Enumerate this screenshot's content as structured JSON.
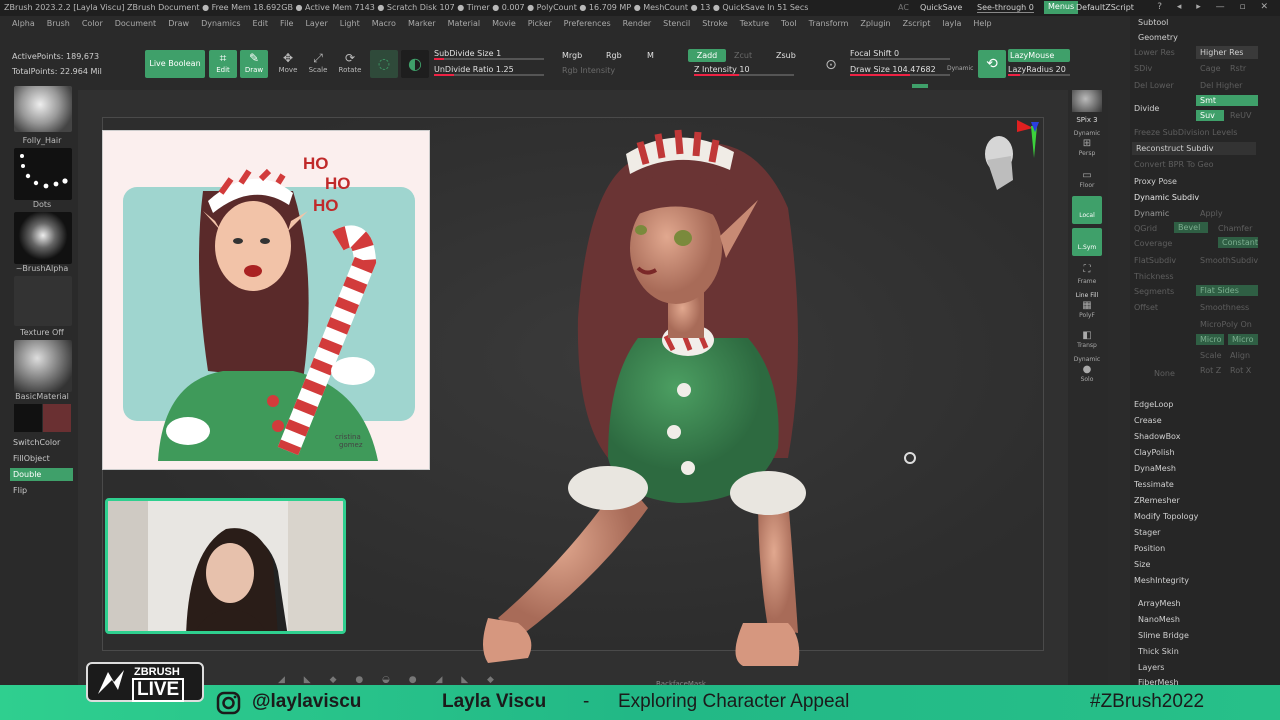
{
  "titlebar": {
    "title": "ZBrush 2023.2.2 [Layla Viscu]   ZBrush Document    ● Free Mem 18.692GB ● Active Mem 7143 ● Scratch Disk 107 ● Timer ● 0.007 ● PolyCount ● 16.709 MP ● MeshCount ● 13 ● QuickSave In 51 Secs",
    "ac": "AC",
    "quicksave": "QuickSave",
    "seethrough": "See-through  0",
    "menus": "Menus",
    "default_script": "DefaultZScript",
    "window_controls": "? ◂ ▸ — ▫ ✕"
  },
  "menubar": [
    "Alpha",
    "Brush",
    "Color",
    "Document",
    "Draw",
    "Dynamics",
    "Edit",
    "File",
    "Layer",
    "Light",
    "Macro",
    "Marker",
    "Material",
    "Movie",
    "Picker",
    "Preferences",
    "Render",
    "Stencil",
    "Stroke",
    "Texture",
    "Tool",
    "Transform",
    "Zplugin",
    "Zscript",
    "layla",
    "Help"
  ],
  "stats": {
    "active_points": "ActivePoints: 189,673",
    "total_points": "TotalPoints: 22.964 Mil"
  },
  "shelf": {
    "live_boolean": "Live Boolean",
    "edit": "Edit",
    "draw": "Draw",
    "move": "Move",
    "scale": "Scale",
    "rotate": "Rotate",
    "subdivide_size": "SubDivide Size 1",
    "undivide_ratio": "UnDivide Ratio 1.25",
    "mrgb": "Mrgb",
    "rgb": "Rgb",
    "m": "M",
    "rgb_intensity": "Rgb Intensity",
    "zadd": "Zadd",
    "zsub": "Zsub",
    "zcut": "Zcut",
    "z_intensity": "Z Intensity 10",
    "focal_shift": "Focal Shift 0",
    "draw_size": "Draw Size 104.47682",
    "dynamic": "Dynamic",
    "lazy_mouse": "LazyMouse",
    "lazy_radius": "LazyRadius 20"
  },
  "left_tray": {
    "brush": "Folly_Hair",
    "stroke": "Dots",
    "alpha": "~BrushAlpha",
    "texture": "Texture Off",
    "material": "BasicMaterial",
    "switch_color": "SwitchColor",
    "fill_object": "FillObject",
    "double": "Double",
    "flip": "Flip"
  },
  "reference": {
    "text": "HO HO HO",
    "signature": "cristina gomez"
  },
  "right_shelf": {
    "spix": "SPix 3",
    "dynamic": "Dynamic",
    "persp": "Persp",
    "floor": "Floor",
    "local": "Local",
    "lsym": "L.Sym",
    "frame": "Frame",
    "line_fill": "Line Fill",
    "polyf": "PolyF",
    "transp": "Transp",
    "dynamic2": "Dynamic",
    "solo": "Solo"
  },
  "panel": {
    "subtool": "Subtool",
    "geometry": "Geometry",
    "lower_res": "Lower Res",
    "higher_res": "Higher Res",
    "sdiv": "SDiv",
    "cage": "Cage",
    "rstr": "Rstr",
    "del_lower": "Del Lower",
    "del_higher": "Del Higher",
    "divide": "Divide",
    "smt": "Smt",
    "suv": "Suv",
    "reuv": "ReUV",
    "freeze": "Freeze SubDivision Levels",
    "reconstruct": "Reconstruct Subdiv",
    "convert_bpr": "Convert BPR To Geo",
    "proxy_pose": "Proxy Pose",
    "dynamic_subdiv": "Dynamic Subdiv",
    "dynamic": "Dynamic",
    "apply": "Apply",
    "qgrid": "QGrid",
    "bevel": "Bevel",
    "chamfer": "Chamfer",
    "coverage": "Coverage",
    "constant": "Constant",
    "flatsubdiv": "FlatSubdiv",
    "smoothsubdiv": "SmoothSubdiv",
    "thickness": "Thickness",
    "segments": "Segments",
    "flat_sides": "Flat Sides",
    "offset": "Offset",
    "smoothness": "Smoothness",
    "micropoly_on": "MicroPoly On",
    "micro_a": "Micro",
    "micro_b": "Micro",
    "scale": "Scale",
    "align": "Align",
    "rot_z": "Rot Z",
    "rot_x": "Rot X",
    "none": "None",
    "edgeloop": "EdgeLoop",
    "crease": "Crease",
    "shadowbox": "ShadowBox",
    "claypolish": "ClayPolish",
    "dynamesh": "DynaMesh",
    "tessimate": "Tessimate",
    "zremesher": "ZRemesher",
    "modify_topology": "Modify Topology",
    "stager": "Stager",
    "position": "Position",
    "size": "Size",
    "meshintegrity": "MeshIntegrity",
    "arraymesh": "ArrayMesh",
    "nanomesh": "NanoMesh",
    "slime_bridge": "Slime Bridge",
    "thick_skin": "Thick Skin",
    "layers": "Layers",
    "fibermesh": "FiberMesh"
  },
  "bottom": {
    "backface_mask": "BackfaceMask"
  },
  "banner": {
    "logo_top": "ZBRUSH",
    "logo_bottom": "LIVE",
    "handle": "@laylaviscu",
    "name": "Layla Viscu",
    "dash": "-",
    "topic": "Exploring Character Appeal",
    "hashtag": "#ZBrush2022"
  },
  "colors": {
    "accent_green": "#3fa06a",
    "banner_green": "#2fcf8f"
  }
}
